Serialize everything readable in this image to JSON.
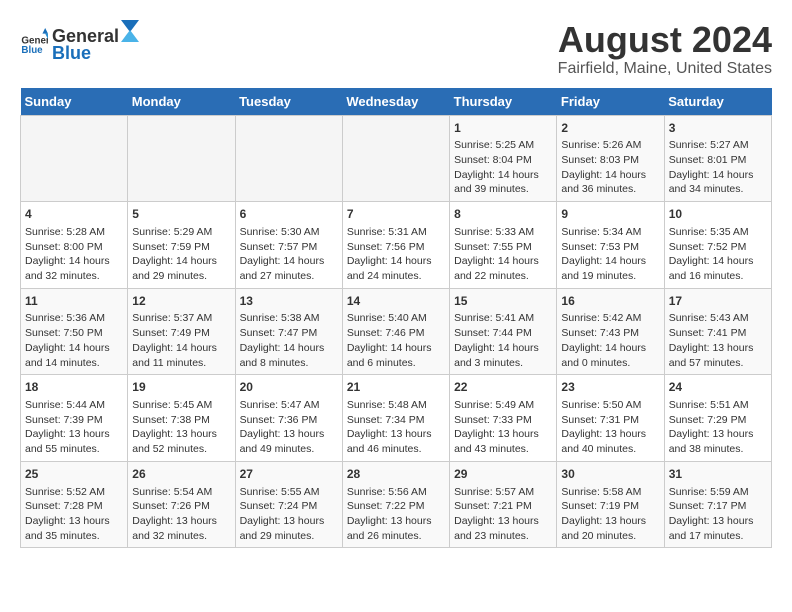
{
  "header": {
    "logo": {
      "general": "General",
      "blue": "Blue"
    },
    "title": "August 2024",
    "subtitle": "Fairfield, Maine, United States"
  },
  "calendar": {
    "days_of_week": [
      "Sunday",
      "Monday",
      "Tuesday",
      "Wednesday",
      "Thursday",
      "Friday",
      "Saturday"
    ],
    "weeks": [
      [
        {
          "day": "",
          "info": ""
        },
        {
          "day": "",
          "info": ""
        },
        {
          "day": "",
          "info": ""
        },
        {
          "day": "",
          "info": ""
        },
        {
          "day": "1",
          "info": "Sunrise: 5:25 AM\nSunset: 8:04 PM\nDaylight: 14 hours\nand 39 minutes."
        },
        {
          "day": "2",
          "info": "Sunrise: 5:26 AM\nSunset: 8:03 PM\nDaylight: 14 hours\nand 36 minutes."
        },
        {
          "day": "3",
          "info": "Sunrise: 5:27 AM\nSunset: 8:01 PM\nDaylight: 14 hours\nand 34 minutes."
        }
      ],
      [
        {
          "day": "4",
          "info": "Sunrise: 5:28 AM\nSunset: 8:00 PM\nDaylight: 14 hours\nand 32 minutes."
        },
        {
          "day": "5",
          "info": "Sunrise: 5:29 AM\nSunset: 7:59 PM\nDaylight: 14 hours\nand 29 minutes."
        },
        {
          "day": "6",
          "info": "Sunrise: 5:30 AM\nSunset: 7:57 PM\nDaylight: 14 hours\nand 27 minutes."
        },
        {
          "day": "7",
          "info": "Sunrise: 5:31 AM\nSunset: 7:56 PM\nDaylight: 14 hours\nand 24 minutes."
        },
        {
          "day": "8",
          "info": "Sunrise: 5:33 AM\nSunset: 7:55 PM\nDaylight: 14 hours\nand 22 minutes."
        },
        {
          "day": "9",
          "info": "Sunrise: 5:34 AM\nSunset: 7:53 PM\nDaylight: 14 hours\nand 19 minutes."
        },
        {
          "day": "10",
          "info": "Sunrise: 5:35 AM\nSunset: 7:52 PM\nDaylight: 14 hours\nand 16 minutes."
        }
      ],
      [
        {
          "day": "11",
          "info": "Sunrise: 5:36 AM\nSunset: 7:50 PM\nDaylight: 14 hours\nand 14 minutes."
        },
        {
          "day": "12",
          "info": "Sunrise: 5:37 AM\nSunset: 7:49 PM\nDaylight: 14 hours\nand 11 minutes."
        },
        {
          "day": "13",
          "info": "Sunrise: 5:38 AM\nSunset: 7:47 PM\nDaylight: 14 hours\nand 8 minutes."
        },
        {
          "day": "14",
          "info": "Sunrise: 5:40 AM\nSunset: 7:46 PM\nDaylight: 14 hours\nand 6 minutes."
        },
        {
          "day": "15",
          "info": "Sunrise: 5:41 AM\nSunset: 7:44 PM\nDaylight: 14 hours\nand 3 minutes."
        },
        {
          "day": "16",
          "info": "Sunrise: 5:42 AM\nSunset: 7:43 PM\nDaylight: 14 hours\nand 0 minutes."
        },
        {
          "day": "17",
          "info": "Sunrise: 5:43 AM\nSunset: 7:41 PM\nDaylight: 13 hours\nand 57 minutes."
        }
      ],
      [
        {
          "day": "18",
          "info": "Sunrise: 5:44 AM\nSunset: 7:39 PM\nDaylight: 13 hours\nand 55 minutes."
        },
        {
          "day": "19",
          "info": "Sunrise: 5:45 AM\nSunset: 7:38 PM\nDaylight: 13 hours\nand 52 minutes."
        },
        {
          "day": "20",
          "info": "Sunrise: 5:47 AM\nSunset: 7:36 PM\nDaylight: 13 hours\nand 49 minutes."
        },
        {
          "day": "21",
          "info": "Sunrise: 5:48 AM\nSunset: 7:34 PM\nDaylight: 13 hours\nand 46 minutes."
        },
        {
          "day": "22",
          "info": "Sunrise: 5:49 AM\nSunset: 7:33 PM\nDaylight: 13 hours\nand 43 minutes."
        },
        {
          "day": "23",
          "info": "Sunrise: 5:50 AM\nSunset: 7:31 PM\nDaylight: 13 hours\nand 40 minutes."
        },
        {
          "day": "24",
          "info": "Sunrise: 5:51 AM\nSunset: 7:29 PM\nDaylight: 13 hours\nand 38 minutes."
        }
      ],
      [
        {
          "day": "25",
          "info": "Sunrise: 5:52 AM\nSunset: 7:28 PM\nDaylight: 13 hours\nand 35 minutes."
        },
        {
          "day": "26",
          "info": "Sunrise: 5:54 AM\nSunset: 7:26 PM\nDaylight: 13 hours\nand 32 minutes."
        },
        {
          "day": "27",
          "info": "Sunrise: 5:55 AM\nSunset: 7:24 PM\nDaylight: 13 hours\nand 29 minutes."
        },
        {
          "day": "28",
          "info": "Sunrise: 5:56 AM\nSunset: 7:22 PM\nDaylight: 13 hours\nand 26 minutes."
        },
        {
          "day": "29",
          "info": "Sunrise: 5:57 AM\nSunset: 7:21 PM\nDaylight: 13 hours\nand 23 minutes."
        },
        {
          "day": "30",
          "info": "Sunrise: 5:58 AM\nSunset: 7:19 PM\nDaylight: 13 hours\nand 20 minutes."
        },
        {
          "day": "31",
          "info": "Sunrise: 5:59 AM\nSunset: 7:17 PM\nDaylight: 13 hours\nand 17 minutes."
        }
      ]
    ]
  }
}
